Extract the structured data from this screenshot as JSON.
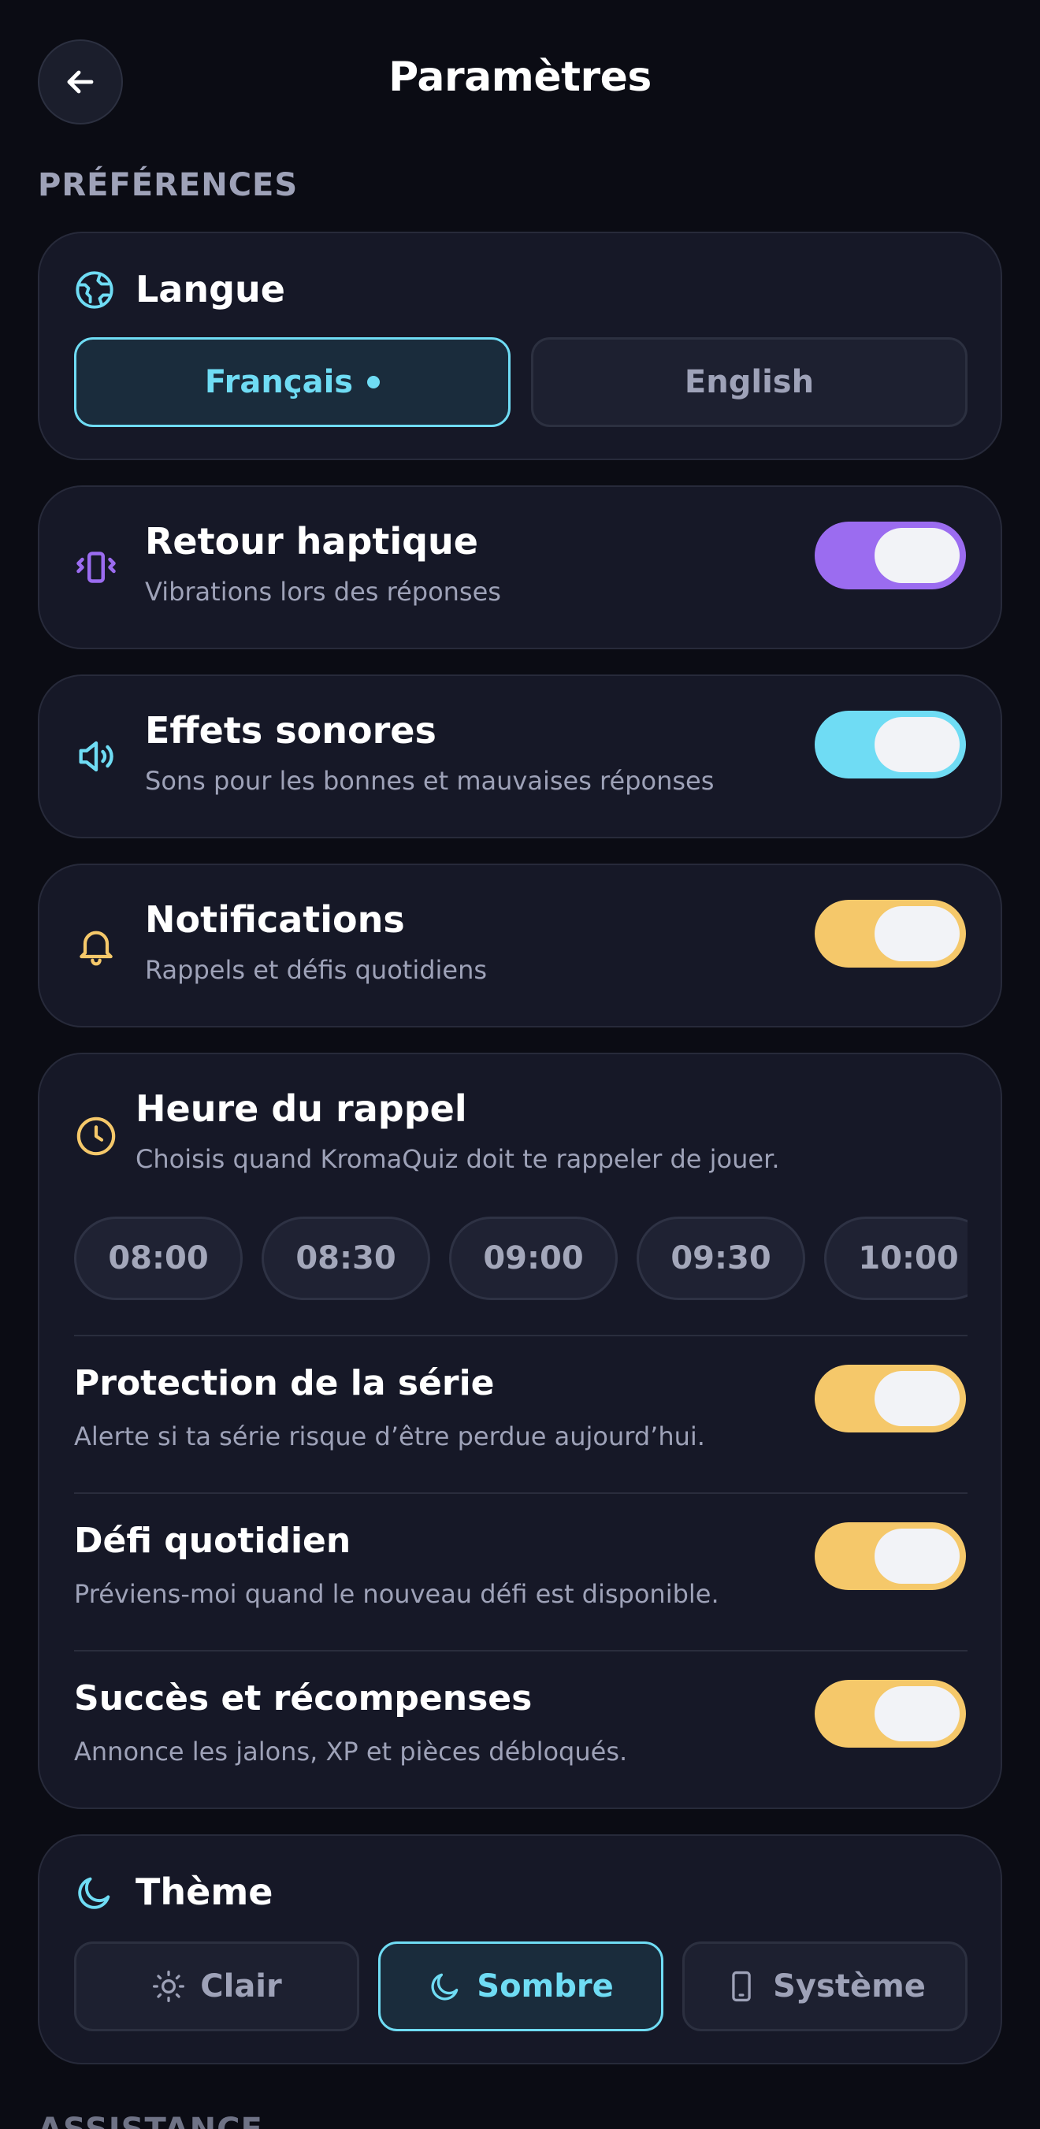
{
  "header": {
    "title": "Paramètres",
    "back_icon": "arrow-left-icon"
  },
  "sections": {
    "preferences": "PRÉFÉRENCES",
    "assistance": "ASSISTANCE"
  },
  "language": {
    "title": "Langue",
    "icon": "globe-icon",
    "options": [
      "Français",
      "English"
    ],
    "selected": "Français"
  },
  "haptics": {
    "title": "Retour haptique",
    "subtitle": "Vibrations lors des réponses",
    "icon": "vibration-icon",
    "enabled": true,
    "color": "#9b6cf0"
  },
  "sounds": {
    "title": "Effets sonores",
    "subtitle": "Sons pour les bonnes et mauvaises réponses",
    "icon": "speaker-icon",
    "enabled": true,
    "color": "#6fdcf4"
  },
  "notifications": {
    "title": "Notifications",
    "subtitle": "Rappels et défis quotidiens",
    "icon": "bell-icon",
    "enabled": true,
    "color": "#f5c86a"
  },
  "reminder": {
    "title": "Heure du rappel",
    "subtitle": "Choisis quand KromaQuiz doit te rappeler de jouer.",
    "icon": "clock-icon",
    "times": [
      "08:00",
      "08:30",
      "09:00",
      "09:30",
      "10:00"
    ]
  },
  "sub_settings": [
    {
      "title": "Protection de la série",
      "subtitle": "Alerte si ta série risque d’être perdue aujourd’hui.",
      "enabled": true
    },
    {
      "title": "Défi quotidien",
      "subtitle": "Préviens-moi quand le nouveau défi est disponible.",
      "enabled": true
    },
    {
      "title": "Succès et récompenses",
      "subtitle": "Annonce les jalons, XP et pièces débloqués.",
      "enabled": true
    }
  ],
  "theme": {
    "title": "Thème",
    "icon": "moon-icon",
    "options": [
      {
        "label": "Clair",
        "icon": "sun-icon"
      },
      {
        "label": "Sombre",
        "icon": "moon-icon"
      },
      {
        "label": "Système",
        "icon": "phone-icon"
      }
    ],
    "selected": "Sombre"
  },
  "colors": {
    "background": "#0b0c14",
    "card": "#161827",
    "accent_cyan": "#6fdcf4",
    "accent_purple": "#9b6cf0",
    "accent_yellow": "#f5c86a"
  }
}
